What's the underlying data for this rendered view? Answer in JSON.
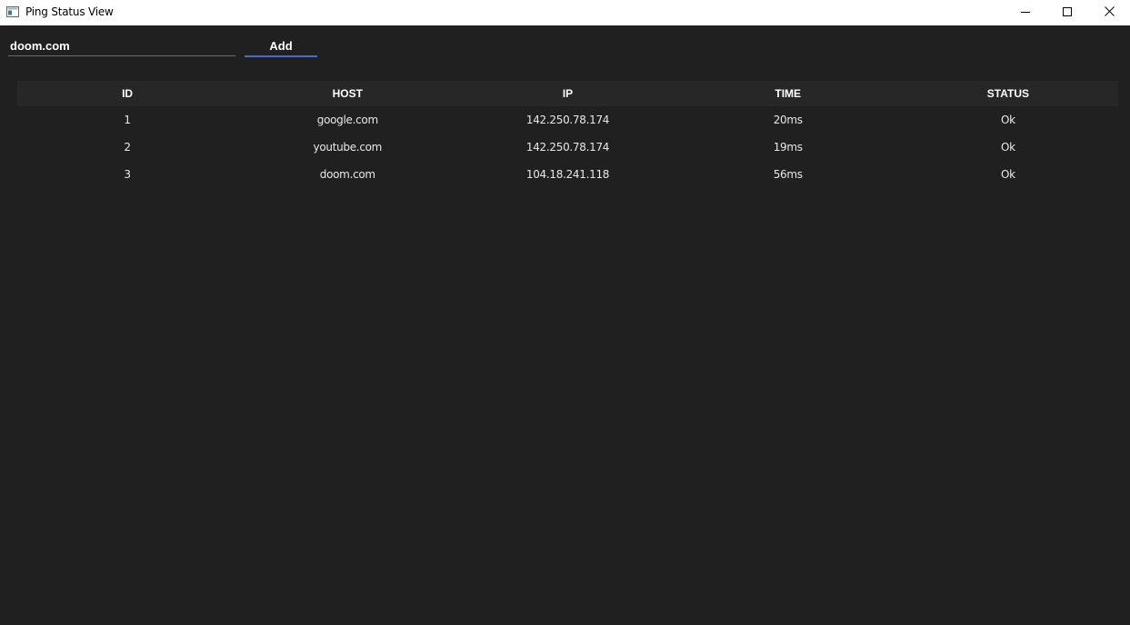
{
  "window": {
    "title": "Ping Status View"
  },
  "toolbar": {
    "host_input_value": "doom.com",
    "add_label": "Add"
  },
  "table": {
    "columns": [
      "ID",
      "HOST",
      "IP",
      "TIME",
      "STATUS"
    ],
    "rows": [
      {
        "id": "1",
        "host": "google.com",
        "ip": "142.250.78.174",
        "time": "20ms",
        "status": "Ok"
      },
      {
        "id": "2",
        "host": "youtube.com",
        "ip": "142.250.78.174",
        "time": "19ms",
        "status": "Ok"
      },
      {
        "id": "3",
        "host": "doom.com",
        "ip": "104.18.241.118",
        "time": "56ms",
        "status": "Ok"
      }
    ]
  },
  "colors": {
    "background": "#202020",
    "header_background": "#272727",
    "accent": "#3b6fe0",
    "text": "#ffffff"
  },
  "icons": {
    "app": "app-window-icon",
    "minimize": "minimize-icon",
    "maximize": "maximize-icon",
    "close": "close-icon"
  }
}
